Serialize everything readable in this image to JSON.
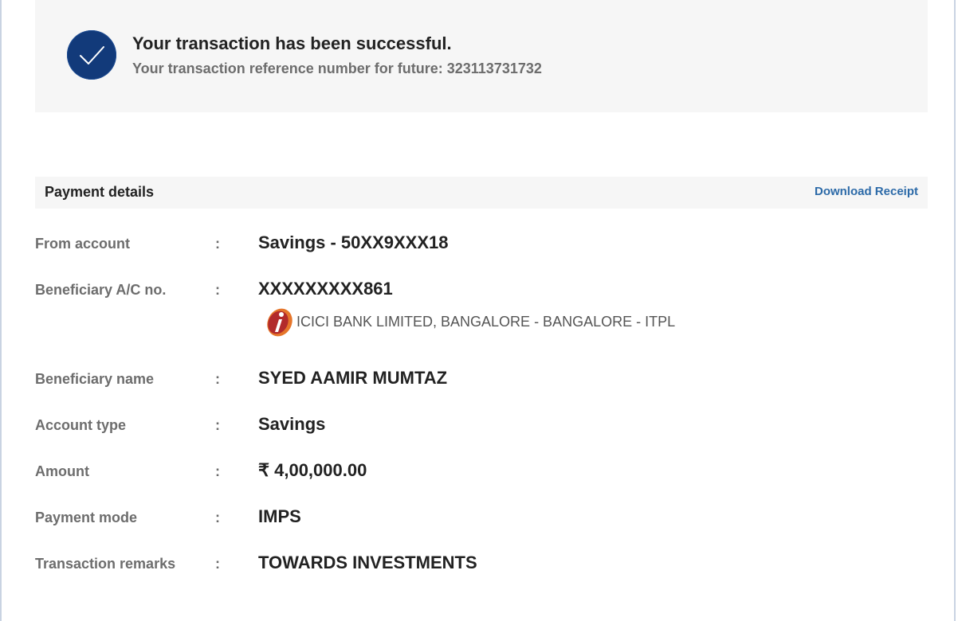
{
  "success": {
    "icon": "checkmark-icon",
    "title": "Your transaction has been successful.",
    "reference": "Your transaction reference number for future: 323113731732"
  },
  "details": {
    "title": "Payment details",
    "download_label": "Download Receipt",
    "colon": ":",
    "rows": [
      {
        "label": "From account",
        "value": "Savings - 50XX9XXX18"
      },
      {
        "label": "Beneficiary A/C no.",
        "value": "XXXXXXXXX861",
        "bank_logo": "icici-bank-logo",
        "bank": "ICICI BANK LIMITED, BANGALORE - BANGALORE - ITPL"
      },
      {
        "label": "Beneficiary name",
        "value": "SYED AAMIR MUMTAZ"
      },
      {
        "label": "Account type",
        "value": "Savings"
      },
      {
        "label": "Amount",
        "value": "₹ 4,00,000.00"
      },
      {
        "label": "Payment mode",
        "value": "IMPS"
      },
      {
        "label": "Transaction remarks",
        "value": "TOWARDS INVESTMENTS"
      }
    ]
  },
  "colors": {
    "success_icon_bg": "#123a7a",
    "panel_bg": "#f6f6f6",
    "link": "#2c6aa8",
    "label": "#6d6d6d",
    "value": "#222222"
  }
}
